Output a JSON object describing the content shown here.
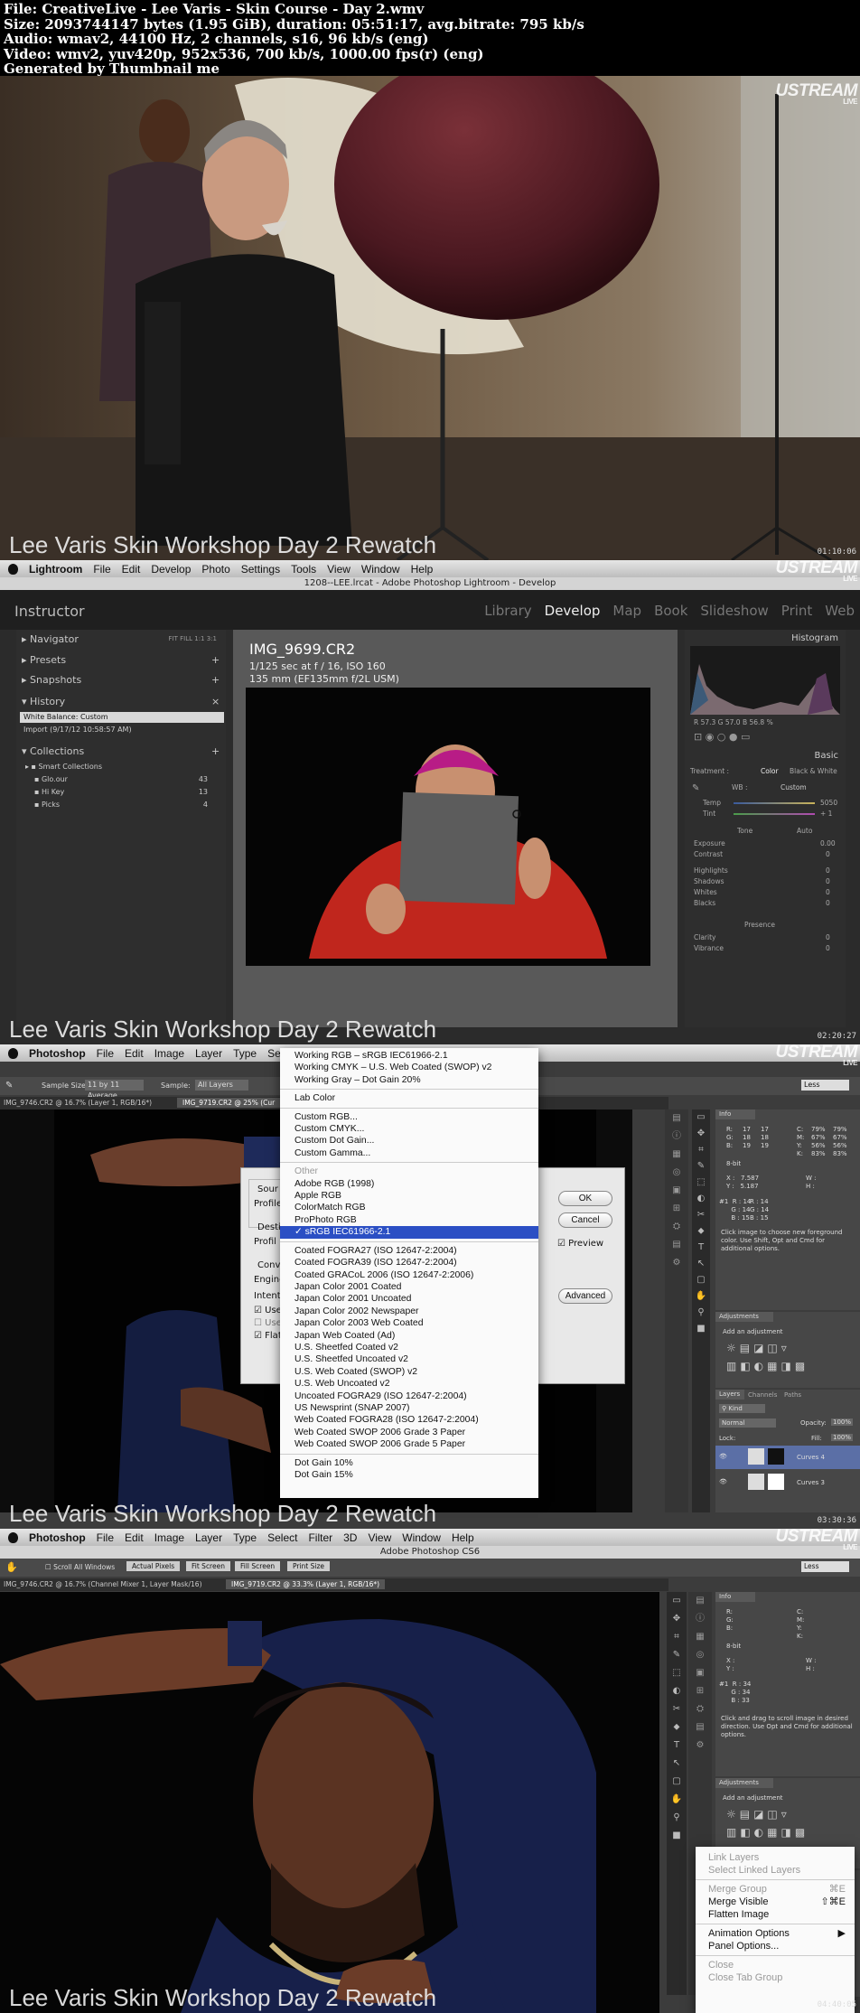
{
  "header": {
    "line1": "File: CreativeLive - Lee Varis - Skin Course - Day 2.wmv",
    "line2": "Size: 2093744147 bytes (1.95 GiB), duration: 05:51:17, avg.bitrate: 795 kb/s",
    "line3": "Audio: wmav2, 44100 Hz, 2 channels, s16, 96 kb/s (eng)",
    "line4": "Video: wmv2, yuv420p, 952x536, 700 kb/s, 1000.00 fps(r) (eng)",
    "line5": "Generated by Thumbnail me"
  },
  "caption": "Lee Varis Skin Workshop Day 2 Rewatch",
  "ustream": {
    "brand": "USTREAM",
    "sub": "LIVE"
  },
  "frames": [
    {
      "timestamp": "01:10:06"
    },
    {
      "timestamp": "02:20:27"
    },
    {
      "timestamp": "03:30:36"
    },
    {
      "timestamp": "04:40:05"
    }
  ],
  "lightroom": {
    "menubar": [
      "Lightroom",
      "File",
      "Edit",
      "Develop",
      "Photo",
      "Settings",
      "Tools",
      "View",
      "Window",
      "Help"
    ],
    "window_title": "1208--LEE.lrcat - Adobe Photoshop Lightroom - Develop",
    "identity": "Instructor",
    "modules": [
      "Library",
      "Develop",
      "Map",
      "Book",
      "Slideshow",
      "Print",
      "Web"
    ],
    "left_panels": [
      "Navigator",
      "Presets",
      "Snapshots",
      "History",
      "Collections"
    ],
    "navigator_zoom": "FIT  FILL  1:1  3:1",
    "history": [
      "White Balance: Custom",
      "Import (9/17/12 10:58:57 AM)"
    ],
    "collections": [
      {
        "name": "Smart Collections",
        "count": ""
      },
      {
        "name": "Glo.our",
        "count": "43"
      },
      {
        "name": "Hi Key",
        "count": "13"
      },
      {
        "name": "Picks",
        "count": "4"
      }
    ],
    "image": {
      "filename": "IMG_9699.CR2",
      "exposure": "1/125 sec at f / 16, ISO 160",
      "lens": "135 mm (EF135mm f/2L USM)"
    },
    "right_panels": {
      "histogram": "Histogram",
      "readout": "R  57.3  G  57.0  B  56.8 %",
      "basic": "Basic",
      "treatment_label": "Treatment :",
      "treatment_color": "Color",
      "treatment_bw": "Black & White",
      "wb_label": "WB :",
      "wb_value": "Custom",
      "temp": {
        "label": "Temp",
        "value": "5050"
      },
      "tint": {
        "label": "Tint",
        "value": "+ 1"
      },
      "tone_label": "Tone",
      "tone_auto": "Auto",
      "tone": [
        {
          "label": "Exposure",
          "value": "0.00"
        },
        {
          "label": "Contrast",
          "value": "0"
        }
      ],
      "tone2": [
        {
          "label": "Highlights",
          "value": "0"
        },
        {
          "label": "Shadows",
          "value": "0"
        },
        {
          "label": "Whites",
          "value": "0"
        },
        {
          "label": "Blacks",
          "value": "0"
        }
      ],
      "presence_label": "Presence",
      "presence": [
        {
          "label": "Clarity",
          "value": "0"
        },
        {
          "label": "Vibrance",
          "value": "0"
        }
      ]
    }
  },
  "photoshop1": {
    "menubar": [
      "Photoshop",
      "File",
      "Edit",
      "Image",
      "Layer",
      "Type",
      "Se"
    ],
    "options": {
      "sample_size_label": "Sample Size:",
      "sample_size": "11 by 11 Average",
      "sample_label": "Sample:",
      "sample": "All Layers"
    },
    "tabs": [
      "IMG_9746.CR2 @ 16.7% (Layer 1, RGB/16*)",
      "IMG_9719.CR2 @ 25% (Cur"
    ],
    "workspace": "Less",
    "menu_items": [
      {
        "label": "Working RGB – sRGB IEC61966-2.1",
        "state": ""
      },
      {
        "label": "Working CMYK – U.S. Web Coated (SWOP) v2",
        "state": ""
      },
      {
        "label": "Working Gray – Dot Gain 20%",
        "state": ""
      },
      {
        "label": "-",
        "state": "sep"
      },
      {
        "label": "Lab Color",
        "state": ""
      },
      {
        "label": "-",
        "state": "sep"
      },
      {
        "label": "Custom RGB...",
        "state": ""
      },
      {
        "label": "Custom CMYK...",
        "state": ""
      },
      {
        "label": "Custom Dot Gain...",
        "state": ""
      },
      {
        "label": "Custom Gamma...",
        "state": ""
      },
      {
        "label": "-",
        "state": "sep"
      },
      {
        "label": "Other",
        "state": "gray"
      },
      {
        "label": "Adobe RGB (1998)",
        "state": ""
      },
      {
        "label": "Apple RGB",
        "state": ""
      },
      {
        "label": "ColorMatch RGB",
        "state": ""
      },
      {
        "label": "ProPhoto RGB",
        "state": ""
      },
      {
        "label": "✓ sRGB IEC61966-2.1",
        "state": "hl"
      },
      {
        "label": "-",
        "state": "sep"
      },
      {
        "label": "Coated FOGRA27 (ISO 12647-2:2004)",
        "state": ""
      },
      {
        "label": "Coated FOGRA39 (ISO 12647-2:2004)",
        "state": ""
      },
      {
        "label": "Coated GRACoL 2006 (ISO 12647-2:2006)",
        "state": ""
      },
      {
        "label": "Japan Color 2001 Coated",
        "state": ""
      },
      {
        "label": "Japan Color 2001 Uncoated",
        "state": ""
      },
      {
        "label": "Japan Color 2002 Newspaper",
        "state": ""
      },
      {
        "label": "Japan Color 2003 Web Coated",
        "state": ""
      },
      {
        "label": "Japan Web Coated (Ad)",
        "state": ""
      },
      {
        "label": "U.S. Sheetfed Coated v2",
        "state": ""
      },
      {
        "label": "U.S. Sheetfed Uncoated v2",
        "state": ""
      },
      {
        "label": "U.S. Web Coated (SWOP) v2",
        "state": ""
      },
      {
        "label": "U.S. Web Uncoated v2",
        "state": ""
      },
      {
        "label": "Uncoated FOGRA29 (ISO 12647-2:2004)",
        "state": ""
      },
      {
        "label": "US Newsprint (SNAP 2007)",
        "state": ""
      },
      {
        "label": "Web Coated FOGRA28 (ISO 12647-2:2004)",
        "state": ""
      },
      {
        "label": "Web Coated SWOP 2006 Grade 3 Paper",
        "state": ""
      },
      {
        "label": "Web Coated SWOP 2006 Grade 5 Paper",
        "state": ""
      },
      {
        "label": "-",
        "state": "sep"
      },
      {
        "label": "Dot Gain 10%",
        "state": ""
      },
      {
        "label": "Dot Gain 15%",
        "state": ""
      }
    ],
    "dialog": {
      "source_label": "Sour",
      "profile_label": "Profile",
      "dest_label": "Desti",
      "profile2_label": "Profil",
      "conv_label": "Conv",
      "engine_label": "Engine",
      "intent_label": "Intent",
      "use_label": "Use",
      "use2_label": "Use",
      "flat_label": "Flat",
      "ok": "OK",
      "cancel": "Cancel",
      "preview": "Preview",
      "advanced": "Advanced"
    },
    "info_panel": {
      "tab": "Info",
      "rgb_labels": "R:\nG:\nB:",
      "rgb_values": "17\n18\n19",
      "rgb_values2": "17\n18\n19",
      "cmyk_labels": "C:\nM:\nY:\nK:",
      "cmyk_values": "79%\n67%\n56%\n83%",
      "cmyk_values2": "79%\n67%\n56%\n83%",
      "bit": "8-bit",
      "xy": "X :   7.587\nY :   5.187",
      "wh_labels": "W :\nH :",
      "hash": "#1  R : 14\n      G : 14\n      B : 15",
      "hash2": "R : 14\nG : 14\nB : 15",
      "hint": "Click image to choose new foreground color.  Use Shift, Opt and Cmd for additional options."
    },
    "adjustments": {
      "tab": "Adjustments",
      "add": "Add an adjustment"
    },
    "layers": {
      "tabs": [
        "Layers",
        "Channels",
        "Paths"
      ],
      "kind": "Kind",
      "blend": "Normal",
      "opacity_label": "Opacity:",
      "opacity": "100%",
      "lock_label": "Lock:",
      "fill_label": "Fill:",
      "fill": "100%",
      "rows": [
        "Curves 4",
        "Curves 3"
      ]
    }
  },
  "photoshop2": {
    "menubar": [
      "Photoshop",
      "File",
      "Edit",
      "Image",
      "Layer",
      "Type",
      "Select",
      "Filter",
      "3D",
      "View",
      "Window",
      "Help"
    ],
    "window_title": "Adobe Photoshop CS6",
    "options": [
      "Scroll All Windows",
      "Actual Pixels",
      "Fit Screen",
      "Fill Screen",
      "Print Size"
    ],
    "tabs": [
      "IMG_9746.CR2 @ 16.7% (Channel Mixer 1, Layer Mask/16)",
      "IMG_9719.CR2 @ 33.3% (Layer 1, RGB/16*)"
    ],
    "workspace": "Less",
    "info_panel": {
      "tab": "Info",
      "rgb_labels": "R:\nG:\nB:",
      "cmyk_labels": "C:\nM:\nY:\nK:",
      "bit": "8-bit",
      "xy": "X :\nY :",
      "wh_labels": "W :\nH :",
      "hash": "#1  R : 34\n      G : 34\n      B : 33",
      "hint": "Click and drag to scroll image in desired direction.  Use Opt and Cmd for additional options."
    },
    "adjustments": {
      "tab": "Adjustments",
      "add": "Add an adjustment"
    },
    "context_menu": [
      {
        "label": "Link Layers",
        "shortcut": "",
        "state": "gray"
      },
      {
        "label": "Select Linked Layers",
        "shortcut": "",
        "state": "gray"
      },
      {
        "label": "-",
        "shortcut": "",
        "state": "sep"
      },
      {
        "label": "Merge Group",
        "shortcut": "⌘E",
        "state": "gray"
      },
      {
        "label": "Merge Visible",
        "shortcut": "⇧⌘E",
        "state": ""
      },
      {
        "label": "Flatten Image",
        "shortcut": "",
        "state": ""
      },
      {
        "label": "-",
        "shortcut": "",
        "state": "sep"
      },
      {
        "label": "Animation Options",
        "shortcut": "▶",
        "state": ""
      },
      {
        "label": "Panel Options...",
        "shortcut": "",
        "state": ""
      },
      {
        "label": "-",
        "shortcut": "",
        "state": "sep"
      },
      {
        "label": "Close",
        "shortcut": "",
        "state": "gray"
      },
      {
        "label": "Close Tab Group",
        "shortcut": "",
        "state": "gray"
      }
    ]
  },
  "colors": {
    "lr_bg": "#2b2b2b",
    "ps_bg": "#3c3c3c",
    "menu_highlight": "#2b4fc4",
    "umbrella": "#5a1e26",
    "shirt_red": "#c0261d",
    "hat_magenta": "#b81c86"
  }
}
